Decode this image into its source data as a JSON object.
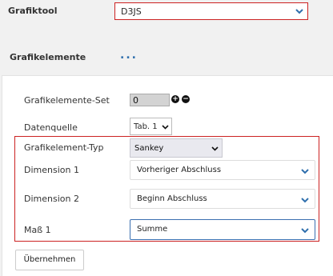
{
  "top": {
    "tool_label": "Grafiktool",
    "tool_value": "D3JS",
    "elements_label": "Grafikelemente",
    "elements_more": "..."
  },
  "form": {
    "set_label": "Grafikelemente-Set",
    "set_value": "0",
    "source_label": "Datenquelle",
    "source_value": "Tab. 1",
    "type_label": "Grafikelement-Typ",
    "type_value": "Sankey",
    "dim1_label": "Dimension 1",
    "dim1_value": "Vorheriger Abschluss",
    "dim2_label": "Dimension 2",
    "dim2_value": "Beginn Abschluss",
    "mass_label": "Maß 1",
    "mass_value": "Summe",
    "apply_label": "Übernehmen"
  },
  "icons": {
    "plus": "plus-circle-icon",
    "minus": "minus-circle-icon",
    "chevron": "chevron-down-icon"
  },
  "colors": {
    "highlight": "#cc2222",
    "accent": "#2f6fad"
  }
}
